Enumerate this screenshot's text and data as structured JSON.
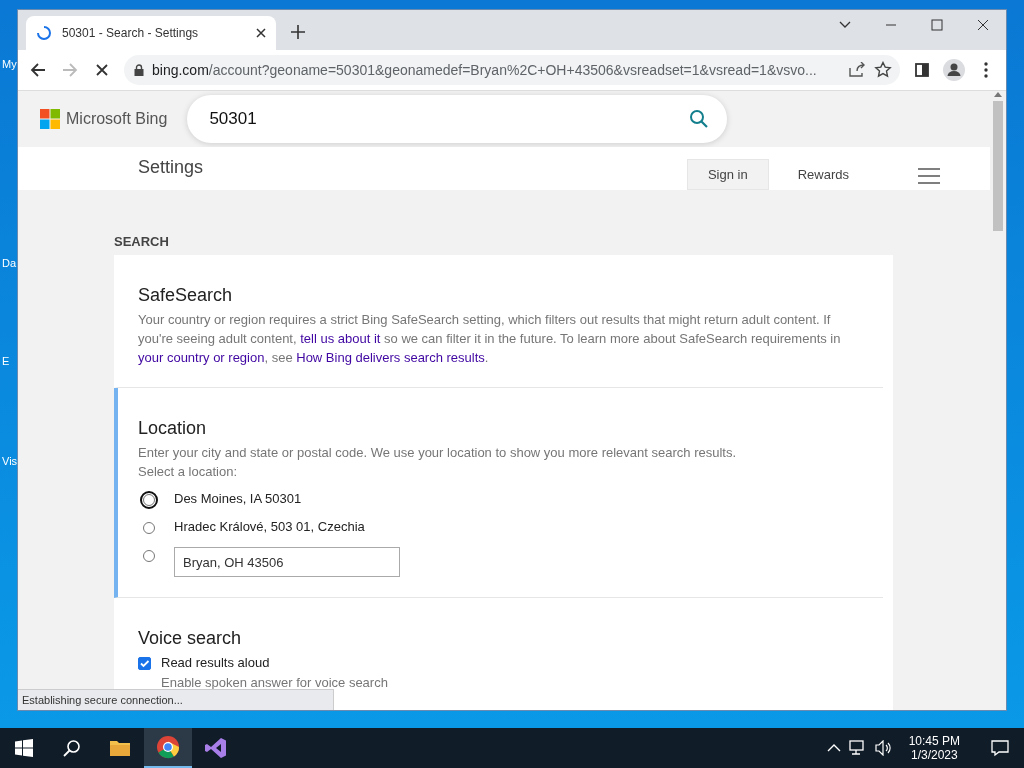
{
  "desktop": {
    "icon_labels": [
      "My",
      "Da",
      "E",
      "Vis"
    ]
  },
  "browser": {
    "tab": {
      "title": "50301 - Search - Settings",
      "loading": true
    },
    "address": {
      "host": "bing.com",
      "path": "/account?geoname=50301&geonamedef=Bryan%2C+OH+43506&vsreadset=1&vsread=1&vsvo..."
    },
    "status": "Establishing secure connection..."
  },
  "page": {
    "logo": "Microsoft Bing",
    "search_value": "50301",
    "header_title": "Settings",
    "nav": [
      {
        "label": "Sign in",
        "selected": true
      },
      {
        "label": "Rewards",
        "selected": false
      }
    ],
    "section_label": "SEARCH",
    "safesearch": {
      "title": "SafeSearch",
      "paragraph": [
        {
          "kind": "text",
          "text": "Your country or region requires a strict Bing SafeSearch setting, which filters out results that might return adult content. If you're seeing adult content, "
        },
        {
          "kind": "link",
          "text": "tell us about it"
        },
        {
          "kind": "text",
          "text": " so we can filter it in the future. To learn more about SafeSearch requirements in "
        },
        {
          "kind": "link",
          "text": "your country or region"
        },
        {
          "kind": "text",
          "text": ", see "
        },
        {
          "kind": "link",
          "text": "How Bing delivers search results"
        },
        {
          "kind": "text",
          "text": "."
        }
      ]
    },
    "location": {
      "title": "Location",
      "active": true,
      "description": "Enter your city and state or postal code. We use your location to show you more relevant search results.",
      "prompt": "Select a location:",
      "options": [
        {
          "kind": "label",
          "label": "Des Moines, IA 50301",
          "selected": false,
          "focused": true
        },
        {
          "kind": "label",
          "label": "Hradec Králové, 503 01, Czechia",
          "selected": false,
          "focused": false
        },
        {
          "kind": "input",
          "value": "Bryan, OH 43506",
          "selected": false,
          "focused": false
        }
      ]
    },
    "voice": {
      "title": "Voice search",
      "option": {
        "label": "Read results aloud",
        "checked": true,
        "hint": "Enable spoken answer for voice search"
      }
    }
  },
  "taskbar": {
    "apps": [
      {
        "kind": "folder",
        "selected": false
      },
      {
        "kind": "chrome",
        "selected": true
      },
      {
        "kind": "studio",
        "selected": false
      }
    ],
    "time": "10:45 PM",
    "date": "1/3/2023"
  }
}
